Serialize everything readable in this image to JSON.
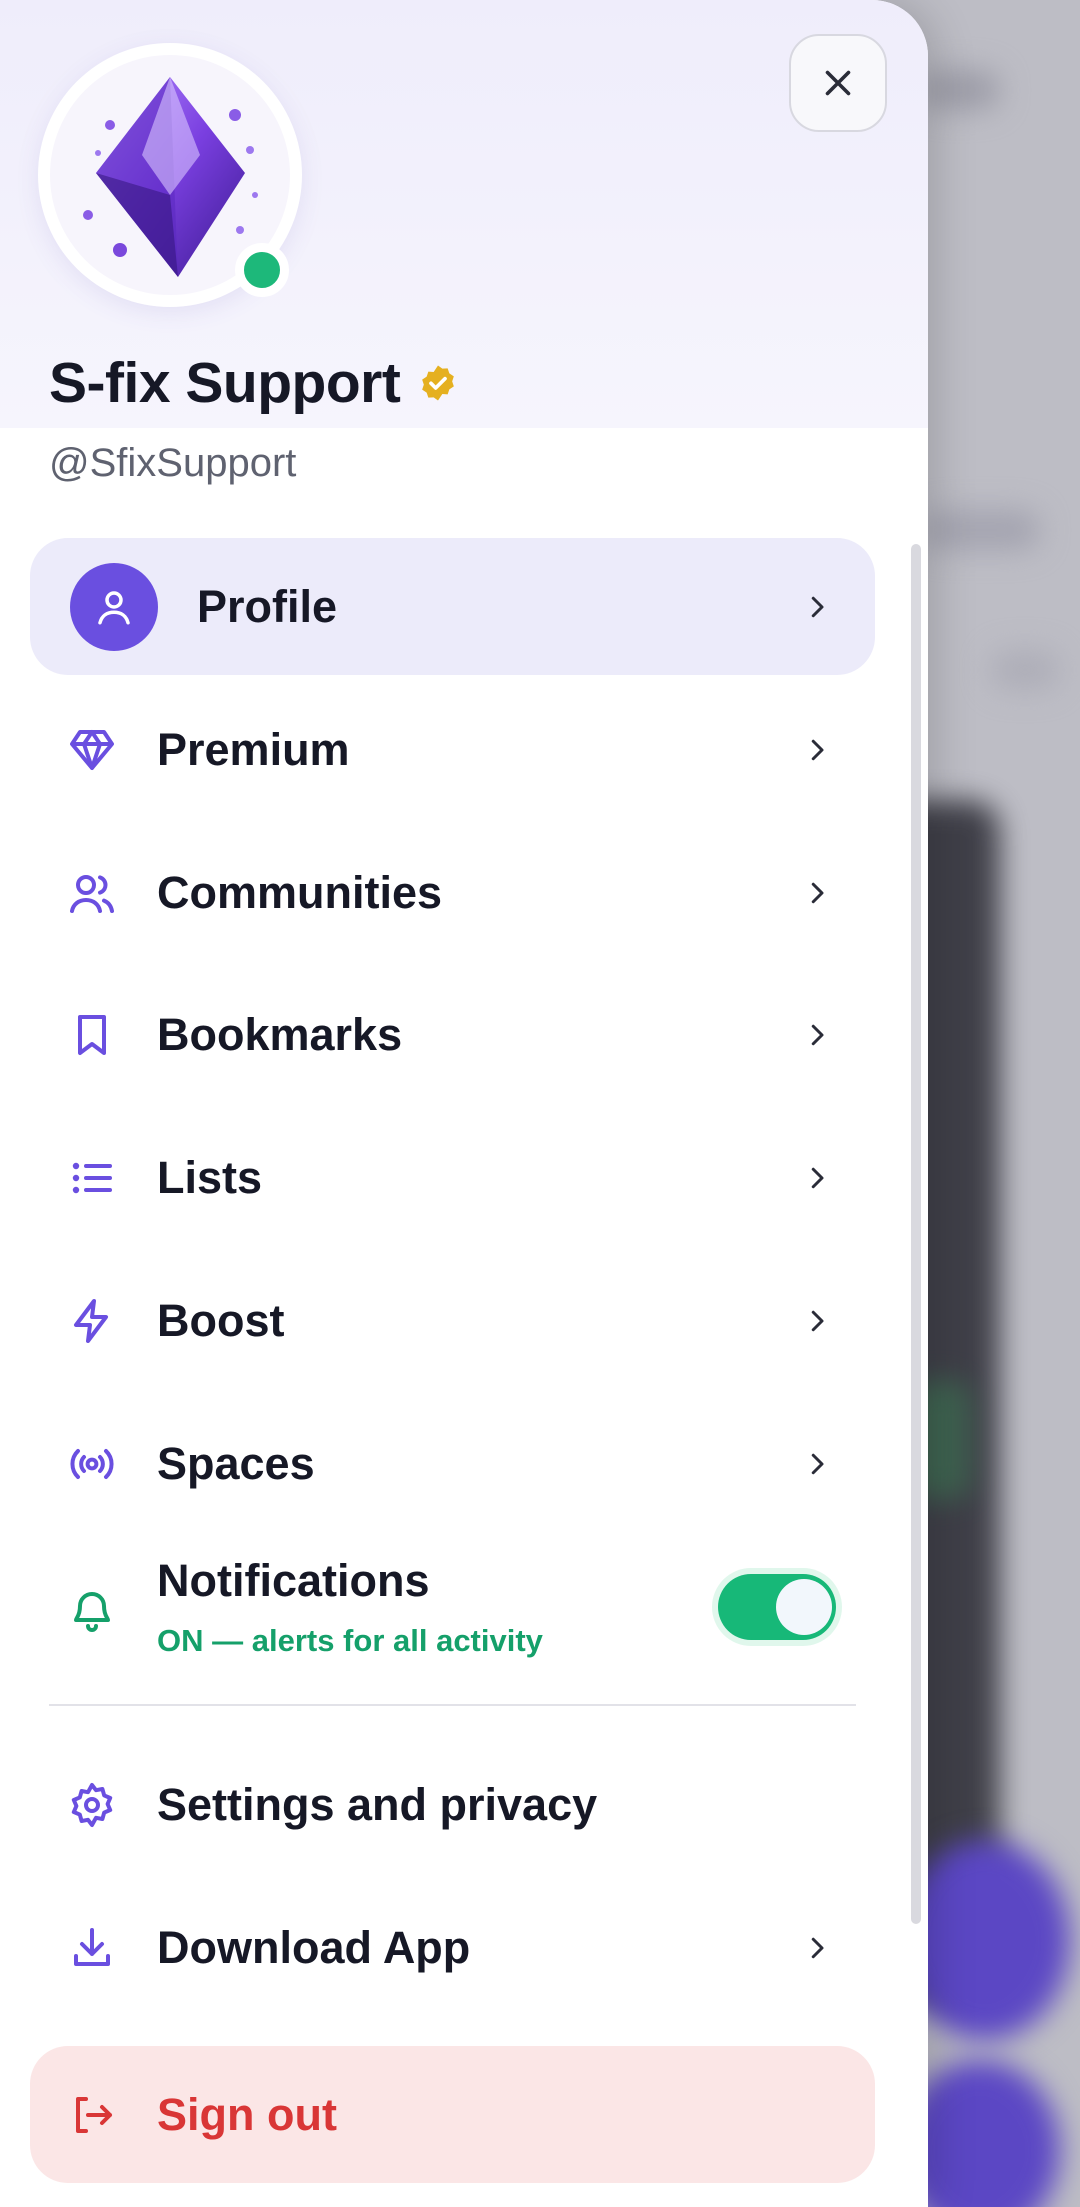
{
  "profile": {
    "name": "S-fix Support",
    "handle": "@SfixSupport",
    "verified": true,
    "online": true
  },
  "menu": {
    "profile": "Profile",
    "premium": "Premium",
    "communities": "Communities",
    "bookmarks": "Bookmarks",
    "lists": "Lists",
    "boost": "Boost",
    "spaces": "Spaces",
    "notifications": {
      "label": "Notifications",
      "status": "ON — alerts for all activity",
      "enabled": true
    },
    "settings": "Settings and privacy",
    "download": "Download App",
    "signout": "Sign out"
  },
  "colors": {
    "accent": "#6a4fe0",
    "success": "#17b878",
    "danger": "#d93636",
    "verified": "#e5b020"
  }
}
